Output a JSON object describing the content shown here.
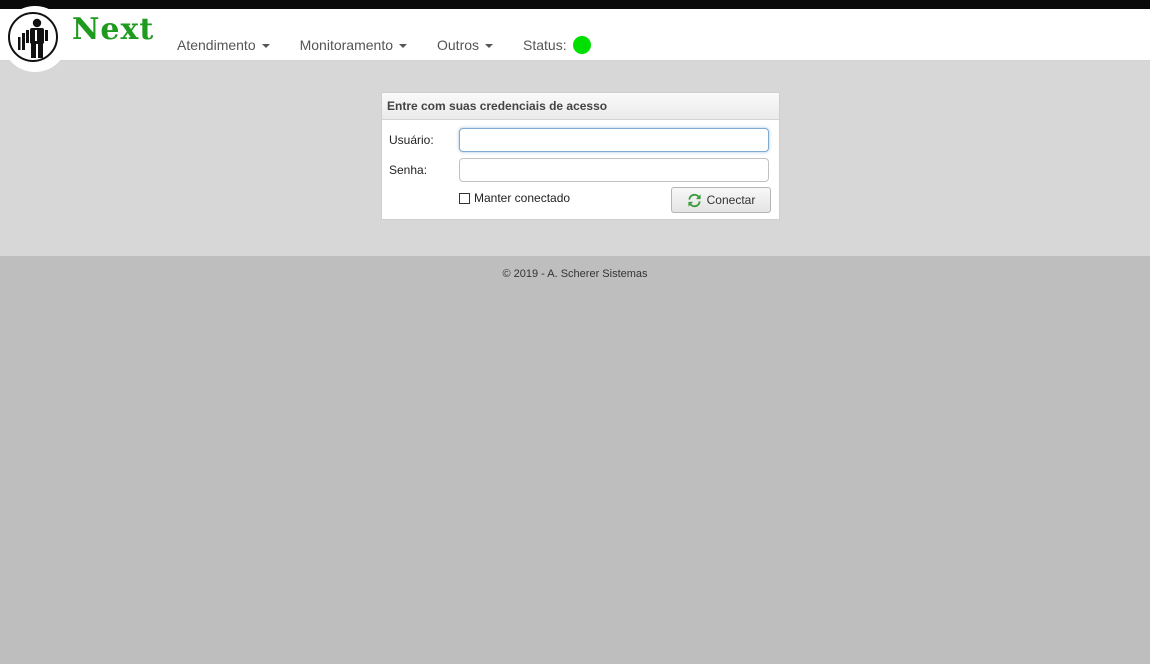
{
  "brand": {
    "name": "Next",
    "color": "#1e9a1e"
  },
  "nav": {
    "items": [
      {
        "label": "Atendimento"
      },
      {
        "label": "Monitoramento"
      },
      {
        "label": "Outros"
      }
    ],
    "status": {
      "label": "Status:",
      "color": "#00e000"
    }
  },
  "login": {
    "title": "Entre com suas credenciais de acesso",
    "username": {
      "label": "Usuário:",
      "value": "",
      "placeholder": ""
    },
    "password": {
      "label": "Senha:",
      "value": "",
      "placeholder": ""
    },
    "remember": {
      "label": "Manter conectado",
      "checked": false
    },
    "submit": {
      "label": "Conectar",
      "icon": "refresh-icon"
    }
  },
  "footer": {
    "text": "© 2019 - A. Scherer Sistemas"
  }
}
